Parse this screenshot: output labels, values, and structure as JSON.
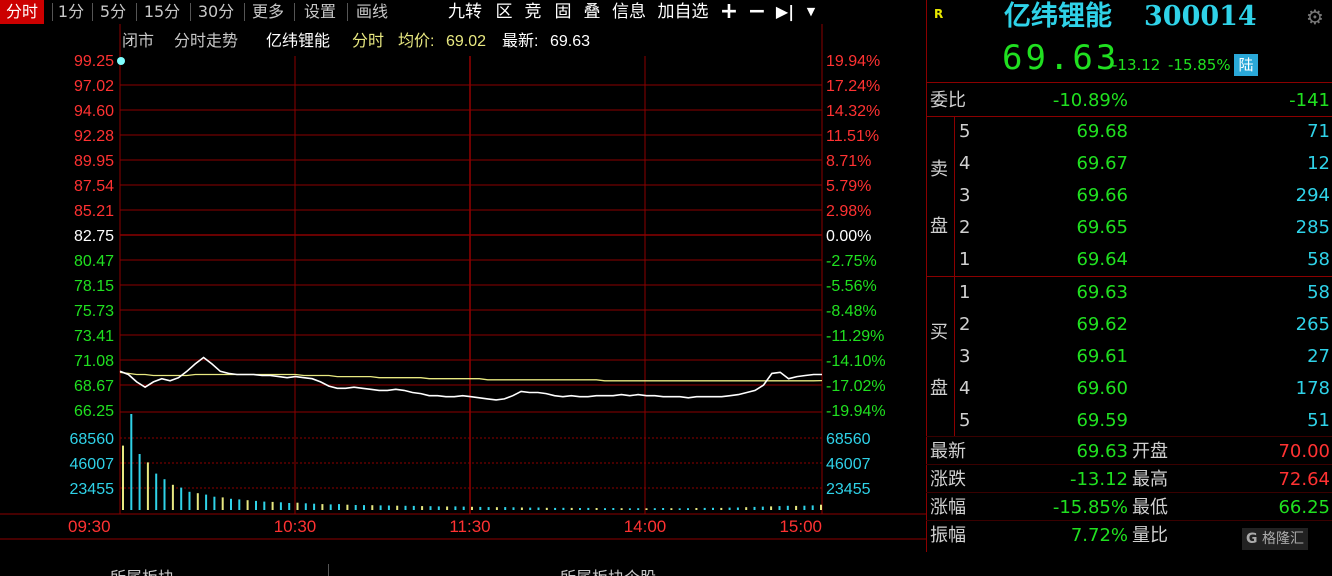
{
  "toolbar": {
    "tabs": [
      "分时",
      "1分",
      "5分",
      "15分",
      "30分",
      "更多",
      "设置",
      "画线"
    ],
    "right_buttons": [
      "九转",
      "区",
      "竞",
      "固",
      "叠",
      "信息",
      "加自选"
    ],
    "icons": [
      "plus-icon",
      "minus-icon",
      "skip-end-icon",
      "dropdown-icon"
    ]
  },
  "chart": {
    "header": {
      "status": "闭市",
      "mode": "分时走势",
      "stock_name": "亿纬锂能",
      "period": "分时",
      "avg_label": "均价:",
      "avg_value": "69.02",
      "last_label": "最新:",
      "last_value": "69.63"
    },
    "price_ticks": [
      "99.25",
      "97.02",
      "94.60",
      "92.28",
      "89.95",
      "87.54",
      "85.21",
      "82.75",
      "80.47",
      "78.15",
      "75.73",
      "73.41",
      "71.08",
      "68.67",
      "66.25"
    ],
    "pct_ticks": [
      "19.94%",
      "17.24%",
      "14.32%",
      "11.51%",
      "8.71%",
      "5.79%",
      "2.98%",
      "0.00%",
      "-2.75%",
      "-5.56%",
      "-8.48%",
      "-11.29%",
      "-14.10%",
      "-17.02%",
      "-19.94%"
    ],
    "volume_ticks": [
      "68560",
      "46007",
      "23455"
    ],
    "time_ticks": [
      "09:30",
      "10:30",
      "11:30",
      "14:00",
      "15:00"
    ],
    "bottom_tabs": [
      "所属板块",
      "所属板块个股"
    ],
    "colors": {
      "up": "#ff3232",
      "down": "#20e020",
      "flat": "#ffffff",
      "grid": "#8b0000",
      "price_line": "#ffffff",
      "avg_line": "#e8e880",
      "volume": "#2fd2e8"
    }
  },
  "chart_data": {
    "type": "line",
    "title": "",
    "xlabel": "",
    "ylabel": "",
    "prev_close": 82.75,
    "ylim": [
      66.25,
      99.25
    ],
    "x_ticks": [
      "09:30",
      "10:30",
      "11:30",
      "14:00",
      "15:00"
    ],
    "series": [
      {
        "values": [
          69.9,
          69.6,
          68.9,
          68.4,
          68.9,
          69.2,
          69.0,
          69.3,
          69.9,
          70.6,
          71.2,
          70.6,
          69.9,
          69.7,
          69.6,
          69.6,
          69.6,
          69.5,
          69.5,
          69.4,
          69.3,
          69.4,
          69.3,
          69.2,
          68.9,
          68.5,
          68.3,
          68.3,
          68.4,
          68.3,
          68.2,
          68.1,
          68.1,
          68.2,
          68.1,
          67.9,
          67.8,
          67.6,
          67.6,
          67.5,
          67.5,
          67.6,
          67.5,
          67.4,
          67.3,
          67.2,
          67.3,
          67.6,
          68.0,
          67.9,
          67.9,
          67.8,
          67.6,
          67.5,
          67.6,
          67.5,
          67.5,
          67.6,
          67.6,
          67.6,
          67.7,
          67.6,
          67.7,
          67.6,
          67.6,
          67.5,
          67.5,
          67.5,
          67.4,
          67.5,
          67.5,
          67.5,
          67.5,
          67.6,
          67.7,
          67.9,
          68.1,
          68.6,
          69.7,
          69.8,
          69.2,
          69.4,
          69.5,
          69.6,
          69.6
        ]
      },
      {
        "values": [
          69.8,
          69.7,
          69.6,
          69.6,
          69.5,
          69.5,
          69.5,
          69.5,
          69.5,
          69.6,
          69.6,
          69.6,
          69.6,
          69.6,
          69.6,
          69.6,
          69.6,
          69.6,
          69.6,
          69.6,
          69.6,
          69.6,
          69.5,
          69.5,
          69.5,
          69.5,
          69.4,
          69.4,
          69.4,
          69.4,
          69.4,
          69.3,
          69.3,
          69.3,
          69.3,
          69.3,
          69.3,
          69.2,
          69.2,
          69.2,
          69.2,
          69.2,
          69.2,
          69.2,
          69.1,
          69.1,
          69.1,
          69.1,
          69.1,
          69.1,
          69.1,
          69.1,
          69.1,
          69.1,
          69.1,
          69.1,
          69.1,
          69.1,
          69.0,
          69.0,
          69.0,
          69.0,
          69.0,
          69.0,
          69.0,
          69.0,
          69.0,
          69.0,
          69.0,
          69.0,
          69.0,
          69.0,
          69.0,
          69.0,
          69.0,
          69.0,
          69.0,
          69.0,
          69.0,
          69.0,
          69.0,
          69.0,
          69.0,
          69.0,
          69.02
        ]
      }
    ],
    "volume": {
      "ylim": [
        0,
        68560
      ],
      "values": [
        46000,
        68560,
        40000,
        34000,
        26000,
        22000,
        18000,
        16000,
        13000,
        12000,
        11000,
        9500,
        9000,
        8000,
        7600,
        7000,
        6500,
        6000,
        5800,
        5500,
        5000,
        5200,
        4800,
        4500,
        4200,
        4000,
        4200,
        3800,
        3600,
        3500,
        3400,
        3300,
        3200,
        3100,
        3000,
        2900,
        2800,
        2700,
        2600,
        2500,
        2600,
        2400,
        2300,
        2200,
        2100,
        2000,
        2100,
        1900,
        1800,
        1700,
        1800,
        1600,
        1500,
        1600,
        1500,
        1400,
        1500,
        1400,
        1300,
        1400,
        1300,
        1200,
        1300,
        1200,
        1300,
        1400,
        1300,
        1200,
        1300,
        1400,
        1500,
        1600,
        1500,
        1700,
        1800,
        2000,
        2200,
        2400,
        2600,
        2800,
        3000,
        2900,
        3100,
        3300,
        3800
      ]
    }
  },
  "quote": {
    "badge": "R",
    "name": "亿纬锂能",
    "code": "300014",
    "price": "69.63",
    "change": "-13.12",
    "change_pct": "-15.85%",
    "market_badge": "陆",
    "committee": {
      "label": "委比",
      "pct": "-10.89%",
      "diff": "-141"
    },
    "sell_label": [
      "卖",
      "盘"
    ],
    "buy_label": [
      "买",
      "盘"
    ],
    "sell": [
      {
        "level": "5",
        "price": "69.68",
        "vol": "71"
      },
      {
        "level": "4",
        "price": "69.67",
        "vol": "12"
      },
      {
        "level": "3",
        "price": "69.66",
        "vol": "294"
      },
      {
        "level": "2",
        "price": "69.65",
        "vol": "285"
      },
      {
        "level": "1",
        "price": "69.64",
        "vol": "58"
      }
    ],
    "buy": [
      {
        "level": "1",
        "price": "69.63",
        "vol": "58"
      },
      {
        "level": "2",
        "price": "69.62",
        "vol": "265"
      },
      {
        "level": "3",
        "price": "69.61",
        "vol": "27"
      },
      {
        "level": "4",
        "price": "69.60",
        "vol": "178"
      },
      {
        "level": "5",
        "price": "69.59",
        "vol": "51"
      }
    ],
    "stats": [
      {
        "l1": "最新",
        "v1": "69.63",
        "l2": "开盘",
        "v2": "70.00"
      },
      {
        "l1": "涨跌",
        "v1": "-13.12",
        "l2": "最高",
        "v2": "72.64"
      },
      {
        "l1": "涨幅",
        "v1": "-15.85%",
        "l2": "最低",
        "v2": "66.25"
      },
      {
        "l1": "振幅",
        "v1": "7.72%",
        "l2": "量比",
        "v2": ""
      }
    ],
    "watermark": "格隆汇"
  }
}
